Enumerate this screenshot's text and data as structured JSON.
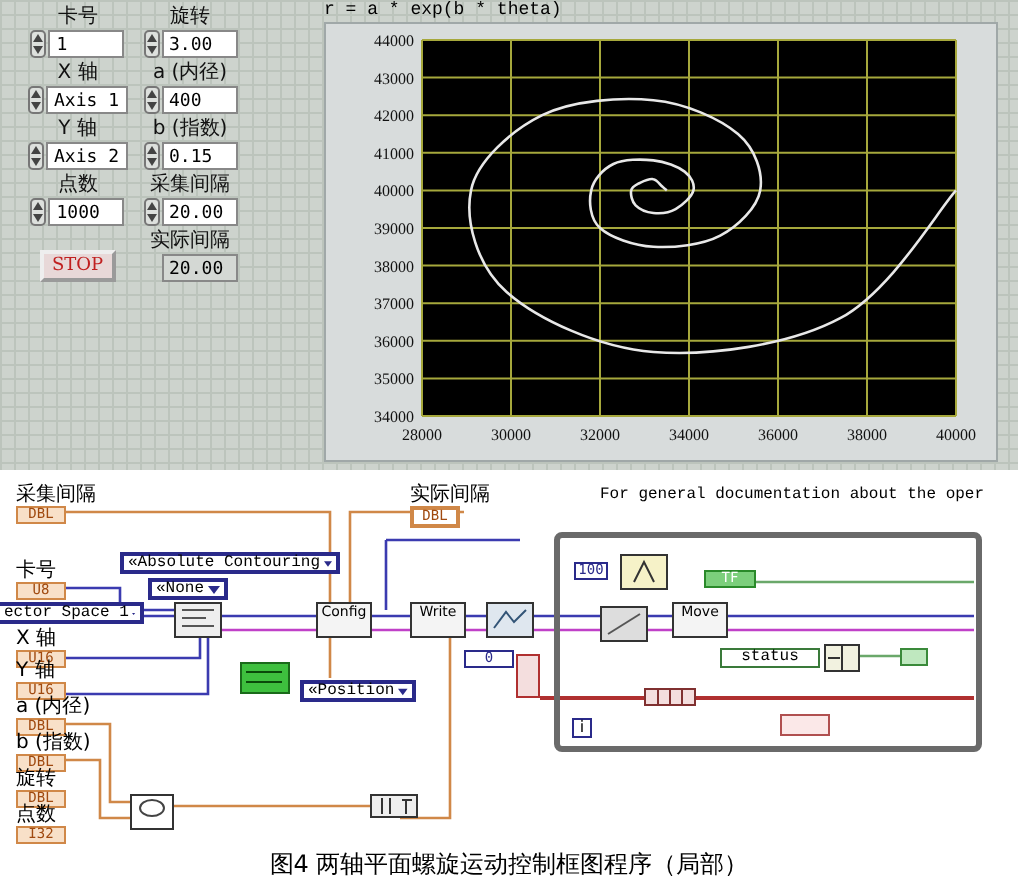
{
  "front_panel": {
    "left_controls": [
      {
        "label": "卡号",
        "value": "1",
        "kind": "control"
      },
      {
        "label": "X 轴",
        "value": "Axis 1",
        "kind": "control"
      },
      {
        "label": "Y 轴",
        "value": "Axis 2",
        "kind": "control"
      },
      {
        "label": "点数",
        "value": "1000",
        "kind": "control"
      }
    ],
    "right_controls": [
      {
        "label": "旋转",
        "value": "3.00",
        "kind": "control"
      },
      {
        "label": "a (内径)",
        "value": "400",
        "kind": "control"
      },
      {
        "label": "b (指数)",
        "value": "0.15",
        "kind": "control"
      },
      {
        "label": "采集间隔",
        "value": "20.00",
        "kind": "control"
      },
      {
        "label": "实际间隔",
        "value": "20.00",
        "kind": "indicator"
      }
    ],
    "stop_button": "STOP",
    "graph": {
      "chart_data": {
        "type": "line",
        "title": "r = a * exp(b * theta)",
        "grid": true,
        "xlim": [
          28000,
          40000
        ],
        "ylim": [
          34000,
          44000
        ],
        "xticks": [
          28000,
          30000,
          32000,
          34000,
          36000,
          38000,
          40000
        ],
        "yticks": [
          34000,
          35000,
          36000,
          37000,
          38000,
          39000,
          40000,
          41000,
          42000,
          43000,
          44000
        ],
        "x": [
          33500,
          33400,
          33200,
          32900,
          32700,
          32800,
          33200,
          33700,
          34100,
          33900,
          33200,
          32300,
          31800,
          32000,
          33200,
          34700,
          35600,
          35100,
          33200,
          30700,
          29100,
          29900,
          33200,
          37400,
          40000
        ],
        "series": [
          {
            "color": "#e8e8e8",
            "values": [
              40000,
              40100,
              40300,
              40200,
              40000,
              39600,
              39400,
              39500,
              40000,
              40500,
              40800,
              40700,
              40000,
              39000,
              38500,
              38800,
              40000,
              41500,
              42400,
              42000,
              40000,
              37300,
              35700,
              36600,
              40000
            ]
          }
        ]
      }
    }
  },
  "block_diagram": {
    "documentation": "For general documentation about the oper",
    "terminals": [
      {
        "label": "采集间隔",
        "type": "DBL",
        "kind": "control"
      },
      {
        "label": "实际间隔",
        "type": "DBL",
        "kind": "indicator"
      },
      {
        "label": "卡号",
        "type": "U8",
        "kind": "control"
      },
      {
        "label": "X 轴",
        "type": "U16",
        "kind": "control"
      },
      {
        "label": "Y 轴",
        "type": "U16",
        "kind": "control"
      },
      {
        "label": "a (内径)",
        "type": "DBL",
        "kind": "control"
      },
      {
        "label": "b (指数)",
        "type": "DBL",
        "kind": "control"
      },
      {
        "label": "旋转",
        "type": "DBL",
        "kind": "control"
      },
      {
        "label": "点数",
        "type": "I32",
        "kind": "control"
      }
    ],
    "rings": [
      "ector Space 1",
      "«Absolute Contouring",
      "«None",
      "«Position"
    ],
    "subvis": [
      "Config",
      "Write",
      "Move"
    ],
    "constants": [
      {
        "text": "100",
        "kind": "numeric"
      },
      {
        "text": "TF",
        "kind": "boolean"
      },
      {
        "text": "0",
        "kind": "numeric"
      }
    ],
    "status_unbundle": "status",
    "loop_index": "i"
  },
  "caption": "图4 两轴平面螺旋运动控制框图程序（局部）"
}
